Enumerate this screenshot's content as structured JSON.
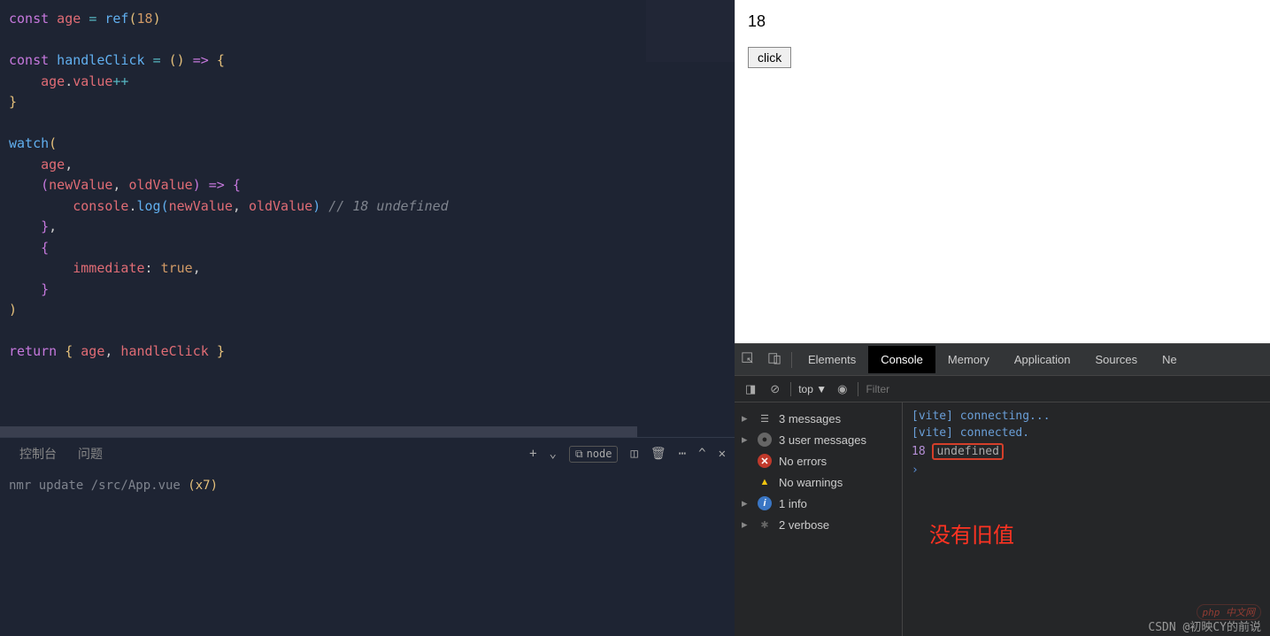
{
  "code": {
    "l1a": "const",
    "l1b": " age ",
    "l1c": "=",
    "l1d": " ref",
    "l1e": "(",
    "l1f": "18",
    "l1g": ")",
    "l3a": "const",
    "l3b": " handleClick ",
    "l3c": "=",
    "l3d": " ",
    "l3e": "()",
    "l3f": " ",
    "l3g": "=>",
    "l3h": " ",
    "l3i": "{",
    "l4a": "    age",
    "l4b": ".",
    "l4c": "value",
    "l4d": "++",
    "l5a": "}",
    "l7a": "watch",
    "l7b": "(",
    "l8a": "    age",
    "l8b": ",",
    "l9a": "    ",
    "l9b": "(",
    "l9c": "newValue",
    "l9d": ", ",
    "l9e": "oldValue",
    "l9f": ")",
    "l9g": " ",
    "l9h": "=>",
    "l9i": " ",
    "l9j": "{",
    "l10a": "        console",
    "l10b": ".",
    "l10c": "log",
    "l10d": "(",
    "l10e": "newValue",
    "l10f": ", ",
    "l10g": "oldValue",
    "l10h": ")",
    "l10i": " // 18 undefined",
    "l11a": "    ",
    "l11b": "}",
    "l11c": ",",
    "l12a": "    ",
    "l12b": "{",
    "l13a": "        immediate",
    "l13b": ":",
    "l13c": " ",
    "l13d": "true",
    "l13e": ",",
    "l14a": "    ",
    "l14b": "}",
    "l15a": ")",
    "l17a": "return",
    "l17b": " ",
    "l17c": "{",
    "l17d": " age",
    "l17e": ",",
    "l17f": " handleClick ",
    "l17g": "}"
  },
  "panel": {
    "tab_console": "控制台",
    "tab_problems": "问题",
    "node_label": "node",
    "hmr_prefix": "nmr update ",
    "hmr_path": "/src/App.vue",
    "hmr_count": " (x7)"
  },
  "preview": {
    "value": "18",
    "button": "click"
  },
  "devtools": {
    "tabs": {
      "elements": "Elements",
      "console": "Console",
      "memory": "Memory",
      "application": "Application",
      "sources": "Sources",
      "ne": "Ne"
    },
    "toolbar": {
      "context": "top ▼",
      "filter_placeholder": "Filter"
    },
    "sidebar": {
      "messages": "3 messages",
      "user": "3 user messages",
      "errors": "No errors",
      "warnings": "No warnings",
      "info": "1 info",
      "verbose": "2 verbose"
    },
    "console": {
      "l1": "[vite] connecting...",
      "l2": "[vite] connected.",
      "l3_num": "18",
      "l3_undef": "undefined",
      "prompt": "›"
    },
    "annotation": "没有旧值",
    "watermark_csdn": "CSDN @初映CY的前说",
    "watermark_php": "php 中文网"
  }
}
